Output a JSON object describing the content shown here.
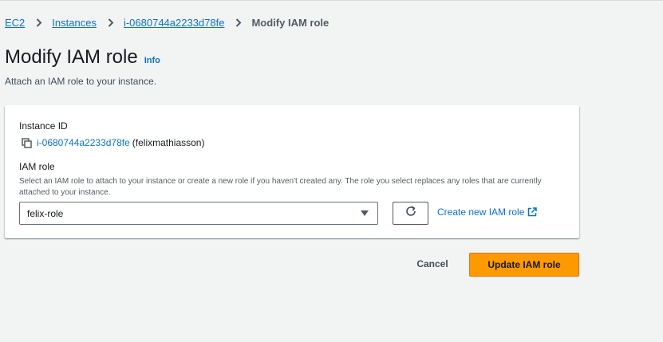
{
  "breadcrumb": {
    "items": [
      "EC2",
      "Instances",
      "i-0680744a2233d78fe"
    ],
    "current": "Modify IAM role"
  },
  "page": {
    "title": "Modify IAM role",
    "info_label": "Info",
    "description": "Attach an IAM role to your instance."
  },
  "form": {
    "instance_id_label": "Instance ID",
    "instance_id": "i-0680744a2233d78fe",
    "instance_owner": "(felixmathiasson)",
    "iam_role_label": "IAM role",
    "iam_role_hint": "Select an IAM role to attach to your instance or create a new role if you haven't created any. The role you select replaces any roles that are currently attached to your instance.",
    "iam_role_value": "felix-role",
    "create_role_label": "Create new IAM role"
  },
  "actions": {
    "cancel_label": "Cancel",
    "submit_label": "Update IAM role"
  },
  "colors": {
    "link": "#0972d3",
    "primary": "#ff9900",
    "background": "#f2f3f3"
  },
  "icons": [
    "chevron-right-icon",
    "copy-icon",
    "caret-down-icon",
    "refresh-icon",
    "external-link-icon"
  ]
}
